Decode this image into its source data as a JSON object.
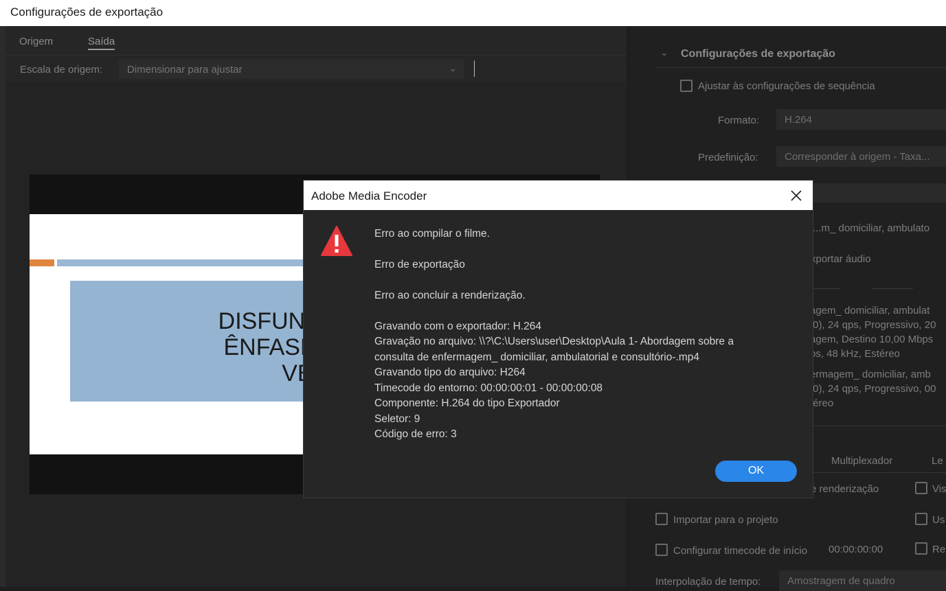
{
  "window": {
    "title": "Configurações de exportação"
  },
  "left": {
    "tabs": [
      {
        "label": "Origem"
      },
      {
        "label": "Saída"
      }
    ],
    "scale_label": "Escala de origem:",
    "scale_value": "Dimensionar para ajustar",
    "slide": {
      "line1": "DISFUNÇÕES MICCI",
      "line2": "ÊNFASE NO CATET",
      "line3": "VESICAL"
    }
  },
  "right": {
    "section_title": "Configurações de exportação",
    "match_sequence": "Ajustar às configurações de sequência",
    "format_label": "Formato:",
    "format_value": "H.264",
    "preset_label": "Predefinição:",
    "preset_value": "Corresponder à origem - Taxa...",
    "output_name": "...m_ domiciliar, ambulato",
    "export_audio": "xportar áudio",
    "summary_lines": [
      "agem_ domiciliar, ambulat",
      ",0), 24 qps, Progressivo, 20",
      "agem, Destino 10,00 Mbps",
      "ps, 48 kHz, Estéreo"
    ],
    "source_lines": [
      "ermagem_ domiciliar, amb",
      ",0), 24  qps, Progressivo, 00",
      "téreo"
    ],
    "tab_multiplexer": "Multiplexador",
    "tab_le": "Le",
    "render_text": "e renderização",
    "vis_text": "Vis",
    "import_project": "Importar para o projeto",
    "us_text": "Us",
    "timecode_label": "Configurar timecode de início",
    "timecode_value": "00:00:00:00",
    "re_text": "Re",
    "interp_label": "Interpolação de tempo:",
    "interp_value": "Amostragem de quadro"
  },
  "dialog": {
    "title": "Adobe Media Encoder",
    "lines": [
      "Erro ao compilar o filme.",
      "Erro de exportação",
      "Erro ao concluir a renderização.",
      "Gravando com o exportador: H.264",
      "Gravação no arquivo: \\\\?\\C:\\Users\\user\\Desktop\\Aula 1-  Abordagem sobre a",
      "consulta de enfermagem_ domiciliar, ambulatorial e consultório-.mp4",
      "Gravando tipo do arquivo: H264",
      "Timecode do entorno: 00:00:00:01 - 00:00:00:08",
      "Componente: H.264 do tipo Exportador",
      "Seletor: 9",
      "Código de erro: 3"
    ],
    "ok_label": "OK",
    "colors": {
      "ok": "#2a86e8",
      "warning": "#e8383d"
    },
    "icons": {
      "warning": "warning-icon",
      "close": "close-icon"
    }
  }
}
